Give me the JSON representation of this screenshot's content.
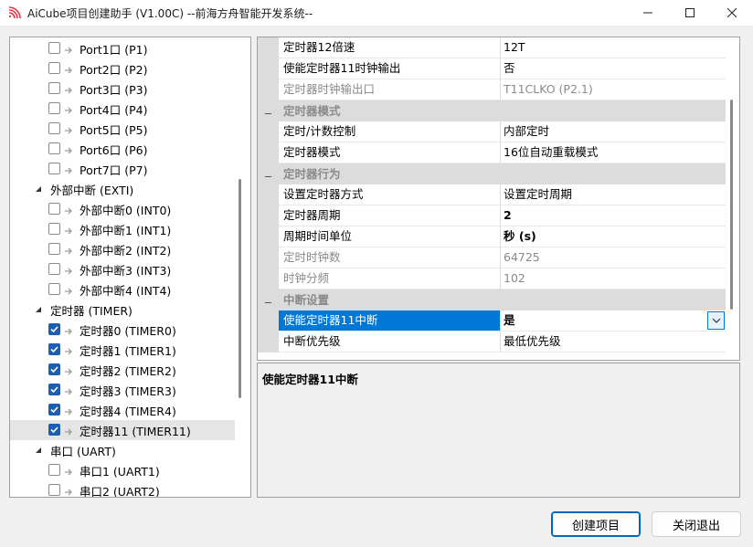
{
  "window": {
    "title": "AiCube项目创建助手 (V1.00C) --前海方舟智能开发系统--"
  },
  "tree": {
    "items": [
      {
        "label": "Port1口 (P1)",
        "level": 2,
        "checked": false
      },
      {
        "label": "Port2口 (P2)",
        "level": 2,
        "checked": false
      },
      {
        "label": "Port3口 (P3)",
        "level": 2,
        "checked": false
      },
      {
        "label": "Port4口 (P4)",
        "level": 2,
        "checked": false
      },
      {
        "label": "Port5口 (P5)",
        "level": 2,
        "checked": false
      },
      {
        "label": "Port6口 (P6)",
        "level": 2,
        "checked": false
      },
      {
        "label": "Port7口 (P7)",
        "level": 2,
        "checked": false
      },
      {
        "label": "外部中断 (EXTI)",
        "level": 1,
        "expanded": true
      },
      {
        "label": "外部中断0 (INT0)",
        "level": 2,
        "checked": false
      },
      {
        "label": "外部中断1 (INT1)",
        "level": 2,
        "checked": false
      },
      {
        "label": "外部中断2 (INT2)",
        "level": 2,
        "checked": false
      },
      {
        "label": "外部中断3 (INT3)",
        "level": 2,
        "checked": false
      },
      {
        "label": "外部中断4 (INT4)",
        "level": 2,
        "checked": false
      },
      {
        "label": "定时器 (TIMER)",
        "level": 1,
        "expanded": true
      },
      {
        "label": "定时器0 (TIMER0)",
        "level": 2,
        "checked": true
      },
      {
        "label": "定时器1 (TIMER1)",
        "level": 2,
        "checked": true
      },
      {
        "label": "定时器2 (TIMER2)",
        "level": 2,
        "checked": true
      },
      {
        "label": "定时器3 (TIMER3)",
        "level": 2,
        "checked": true
      },
      {
        "label": "定时器4 (TIMER4)",
        "level": 2,
        "checked": true
      },
      {
        "label": "定时器11 (TIMER11)",
        "level": 2,
        "checked": true,
        "selected": true
      },
      {
        "label": "串口 (UART)",
        "level": 1,
        "expanded": true
      },
      {
        "label": "串口1 (UART1)",
        "level": 2,
        "checked": false
      },
      {
        "label": "串口2 (UART2)",
        "level": 2,
        "checked": false
      }
    ]
  },
  "properties": {
    "rows": [
      {
        "type": "prop",
        "name": "定时器12倍速",
        "value": "12T"
      },
      {
        "type": "prop",
        "name": "使能定时器11时钟输出",
        "value": "否"
      },
      {
        "type": "prop",
        "name": "定时器时钟输出口",
        "value": "T11CLKO (P2.1)",
        "disabled": true
      },
      {
        "type": "category",
        "name": "定时器模式"
      },
      {
        "type": "prop",
        "name": "定时/计数控制",
        "value": "内部定时"
      },
      {
        "type": "prop",
        "name": "定时器模式",
        "value": "16位自动重载模式"
      },
      {
        "type": "category",
        "name": "定时器行为"
      },
      {
        "type": "prop",
        "name": "设置定时器方式",
        "value": "设置定时周期"
      },
      {
        "type": "prop",
        "name": "定时器周期",
        "value": "2",
        "bold": true
      },
      {
        "type": "prop",
        "name": "周期时间单位",
        "value": "秒 (s)",
        "bold": true
      },
      {
        "type": "prop",
        "name": "定时时钟数",
        "value": "64725",
        "disabled": true
      },
      {
        "type": "prop",
        "name": "时钟分频",
        "value": "102",
        "disabled": true
      },
      {
        "type": "category",
        "name": "中断设置"
      },
      {
        "type": "prop",
        "name": "使能定时器11中断",
        "value": "是",
        "selected": true,
        "dropdown": true
      },
      {
        "type": "prop",
        "name": "中断优先级",
        "value": "最低优先级"
      }
    ]
  },
  "description": {
    "title": "使能定时器11中断"
  },
  "buttons": {
    "create": "创建项目",
    "close": "关闭退出"
  }
}
